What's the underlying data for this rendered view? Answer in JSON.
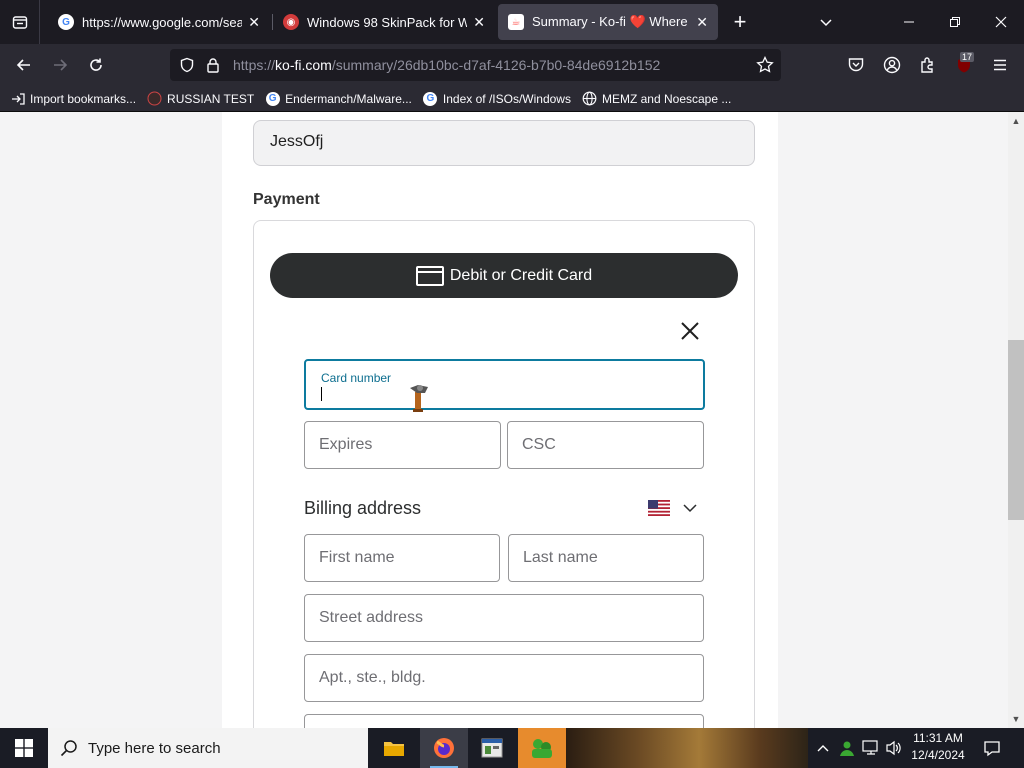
{
  "browser": {
    "tabs": [
      {
        "title": "https://www.google.com/search",
        "favicon": "google-icon"
      },
      {
        "title": "Windows 98 SkinPack for Win10",
        "favicon": "skinpack-icon"
      },
      {
        "title": "Summary - Ko-fi ❤️ Where crea",
        "favicon": "kofi-icon",
        "active": true
      }
    ],
    "url_domain": "ko-fi.com",
    "url_prefix": "https://",
    "url_path": "/summary/26db10bc-d7af-4126-b7b0-84de6912b152",
    "extension_badge": "17",
    "bookmarks": [
      {
        "label": "Import bookmarks...",
        "icon": "import-icon"
      },
      {
        "label": "RUSSIAN TEST",
        "icon": "russian-icon"
      },
      {
        "label": "Endermanch/Malware...",
        "icon": "google-icon"
      },
      {
        "label": "Index of /ISOs/Windows",
        "icon": "google-icon"
      },
      {
        "label": "MEMZ and Noescape ...",
        "icon": "globe-icon"
      }
    ]
  },
  "page": {
    "name_value": "JessOfj",
    "payment_label": "Payment",
    "card_button_label": "Debit or Credit Card",
    "card_number_label": "Card number",
    "expires_placeholder": "Expires",
    "csc_placeholder": "CSC",
    "billing_address_label": "Billing address",
    "first_name_placeholder": "First name",
    "last_name_placeholder": "Last name",
    "street_placeholder": "Street address",
    "apt_placeholder": "Apt., ste., bldg."
  },
  "taskbar": {
    "search_placeholder": "Type here to search",
    "time": "11:31 AM",
    "date": "12/4/2024"
  },
  "colors": {
    "accent": "#0d7b9f",
    "card_button_bg": "#2c2e2f"
  }
}
